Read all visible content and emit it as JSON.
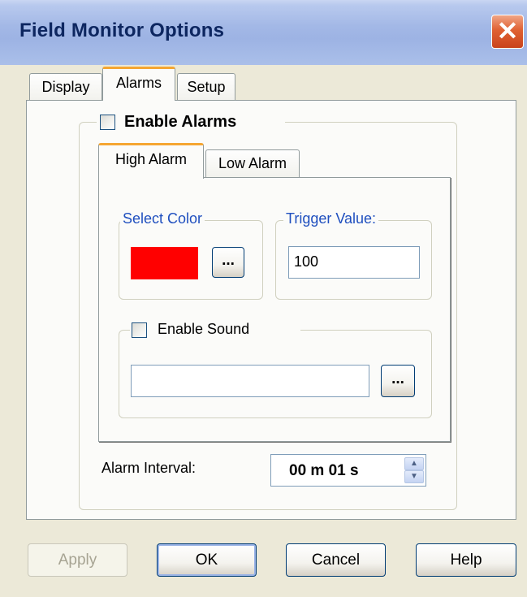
{
  "window": {
    "title": "Field Monitor Options"
  },
  "tabs": [
    "Display",
    "Alarms",
    "Setup"
  ],
  "enable_alarms": {
    "label": "Enable Alarms",
    "checked": false
  },
  "alarm_tabs": [
    "High Alarm",
    "Low Alarm"
  ],
  "select_color": {
    "legend": "Select Color",
    "color": "#ff0000",
    "browse_label": "..."
  },
  "trigger": {
    "legend": "Trigger Value:",
    "value": "100"
  },
  "sound": {
    "label": "Enable Sound",
    "checked": false,
    "file_value": "",
    "browse_label": "..."
  },
  "interval": {
    "label": "Alarm Interval:",
    "value": "00 m 01 s"
  },
  "buttons": {
    "apply": "Apply",
    "ok": "OK",
    "cancel": "Cancel",
    "help": "Help"
  }
}
